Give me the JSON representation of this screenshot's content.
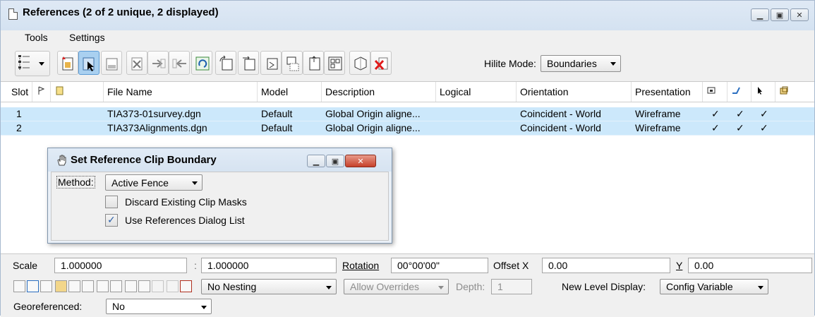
{
  "window": {
    "title": "References (2 of 2 unique, 2 displayed)",
    "controls": [
      "minimize-icon",
      "maximize-icon",
      "close-icon"
    ]
  },
  "menu": {
    "tools": "Tools",
    "settings": "Settings"
  },
  "toolbar": {
    "hilite_label": "Hilite Mode:",
    "hilite_value": "Boundaries"
  },
  "table": {
    "columns": [
      "Slot",
      "File Name",
      "Model",
      "Description",
      "Logical",
      "Orientation",
      "Presentation"
    ],
    "rows": [
      {
        "slot": "1",
        "file": "TIA373-01survey.dgn",
        "model": "Default",
        "description": "Global Origin aligne...",
        "logical": "",
        "orientation": "Coincident - World",
        "presentation": "Wireframe",
        "c1": "✓",
        "c2": "✓",
        "c3": "✓"
      },
      {
        "slot": "2",
        "file": "TIA373Alignments.dgn",
        "model": "Default",
        "description": "Global Origin aligne...",
        "logical": "",
        "orientation": "Coincident - World",
        "presentation": "Wireframe",
        "c1": "✓",
        "c2": "✓",
        "c3": "✓"
      }
    ]
  },
  "dialog": {
    "title": "Set Reference Clip Boundary",
    "method_label": "Method:",
    "method_value": "Active Fence",
    "discard_label": "Discard Existing Clip Masks",
    "discard_checked": false,
    "use_refs_label": "Use References Dialog List",
    "use_refs_checked": true
  },
  "bottom": {
    "scale_label": "Scale",
    "scale1": "1.000000",
    "colon": ":",
    "scale2": "1.000000",
    "rotation_label": "Rotation",
    "rotation_value": "00°00'00\"",
    "offset_x_label": "Offset X",
    "offset_x_value": "0.00",
    "y_label": "Y",
    "y_value": "0.00",
    "nesting_value": "No Nesting",
    "overrides_value": "Allow Overrides",
    "depth_label": "Depth:",
    "depth_value": "1",
    "new_level_label": "New Level Display:",
    "new_level_value": "Config Variable",
    "georef_label": "Georeferenced:",
    "georef_value": "No"
  }
}
